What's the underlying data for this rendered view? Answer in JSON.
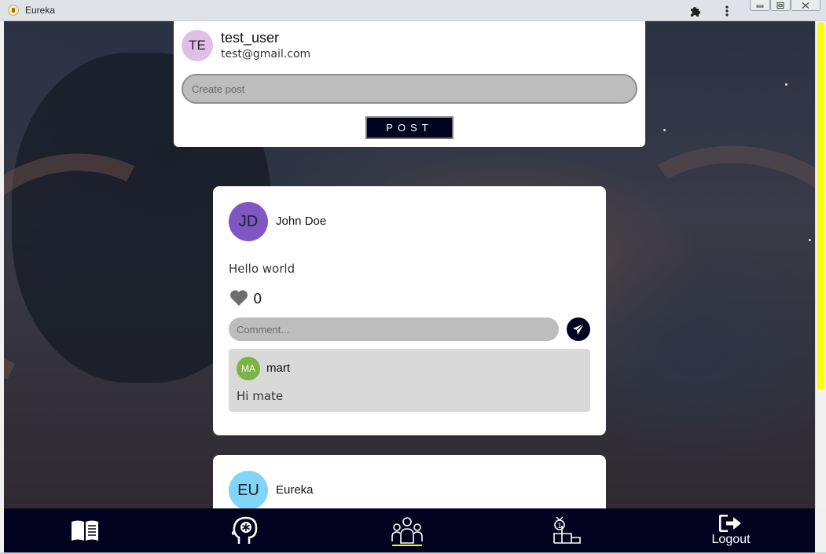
{
  "window": {
    "title": "Eureka",
    "icons": [
      "app-icon",
      "puzzle-icon",
      "kebab-menu-icon",
      "minimize-icon",
      "maximize-icon",
      "close-icon"
    ]
  },
  "create_post": {
    "avatar_initials": "TE",
    "avatar_color": "#e1bee7",
    "username": "test_user",
    "email": "test@gmail.com",
    "input_placeholder": "Create post",
    "post_button_label": "POST"
  },
  "posts": [
    {
      "avatar_initials": "JD",
      "avatar_color": "#7e57c2",
      "author": "John Doe",
      "text": "Hello world",
      "likes": "0",
      "comment_placeholder": "Comment...",
      "comments": [
        {
          "avatar_initials": "MA",
          "avatar_color": "#7cb342",
          "author": "mart",
          "text": "Hi mate"
        }
      ]
    },
    {
      "avatar_initials": "EU",
      "avatar_color": "#81d4fa",
      "author": "Eureka"
    }
  ],
  "bottom_nav": {
    "items": [
      {
        "icon": "book-icon",
        "label": ""
      },
      {
        "icon": "mind-icon",
        "label": ""
      },
      {
        "icon": "community-icon",
        "label": "",
        "active": true
      },
      {
        "icon": "leaderboard-icon",
        "label": ""
      },
      {
        "icon": "logout-icon",
        "label": "Logout"
      }
    ]
  },
  "colors": {
    "nav_background": "#04031f",
    "active_indicator": "#ffff00",
    "scrollbar_thumb": "#ffff00"
  }
}
